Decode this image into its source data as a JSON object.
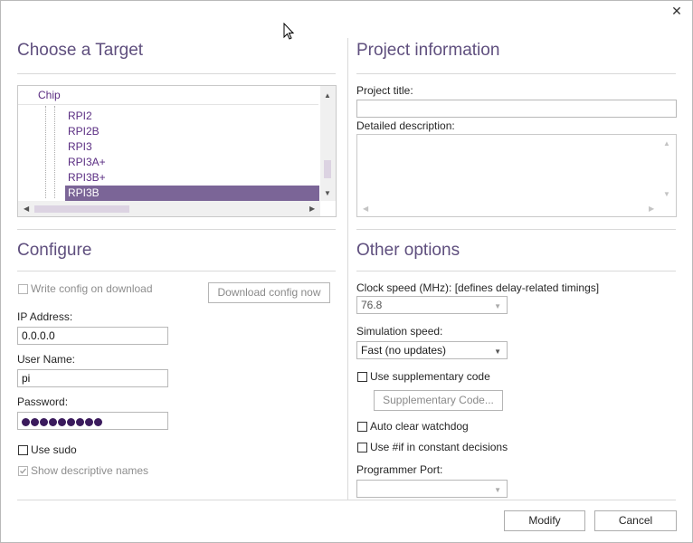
{
  "window": {
    "close_glyph": "✕"
  },
  "target": {
    "title": "Choose a Target",
    "tree": {
      "root": "Chip",
      "items": [
        "RPI2",
        "RPI2B",
        "RPI3",
        "RPI3A+",
        "RPI3B+",
        "RPI3B"
      ],
      "selected": "RPI3B"
    }
  },
  "configure": {
    "title": "Configure",
    "write_config_label": "Write config on download",
    "write_config_checked": false,
    "download_button": "Download config now",
    "ip_label": "IP Address:",
    "ip_value": "0.0.0.0",
    "user_label": "User Name:",
    "user_value": "pi",
    "password_label": "Password:",
    "password_dots": 9,
    "sudo_label": "Use sudo",
    "sudo_checked": false,
    "descriptive_label": "Show descriptive names",
    "descriptive_checked": true
  },
  "project": {
    "title": "Project information",
    "project_title_label": "Project title:",
    "project_title_value": "",
    "description_label": "Detailed description:",
    "description_value": ""
  },
  "options": {
    "title": "Other options",
    "clock_label": "Clock speed (MHz): [defines delay-related timings]",
    "clock_value": "76.8",
    "sim_label": "Simulation speed:",
    "sim_value": "Fast (no updates)",
    "supp_label": "Use supplementary code",
    "supp_button": "Supplementary Code...",
    "watchdog_label": "Auto clear watchdog",
    "ifdef_label": "Use #if in constant decisions",
    "port_label": "Programmer Port:",
    "port_value": ""
  },
  "footer": {
    "modify": "Modify",
    "cancel": "Cancel"
  },
  "colors": {
    "accent": "#5f4f7e",
    "selection": "#7b6597",
    "tree_text": "#5a2d82"
  }
}
